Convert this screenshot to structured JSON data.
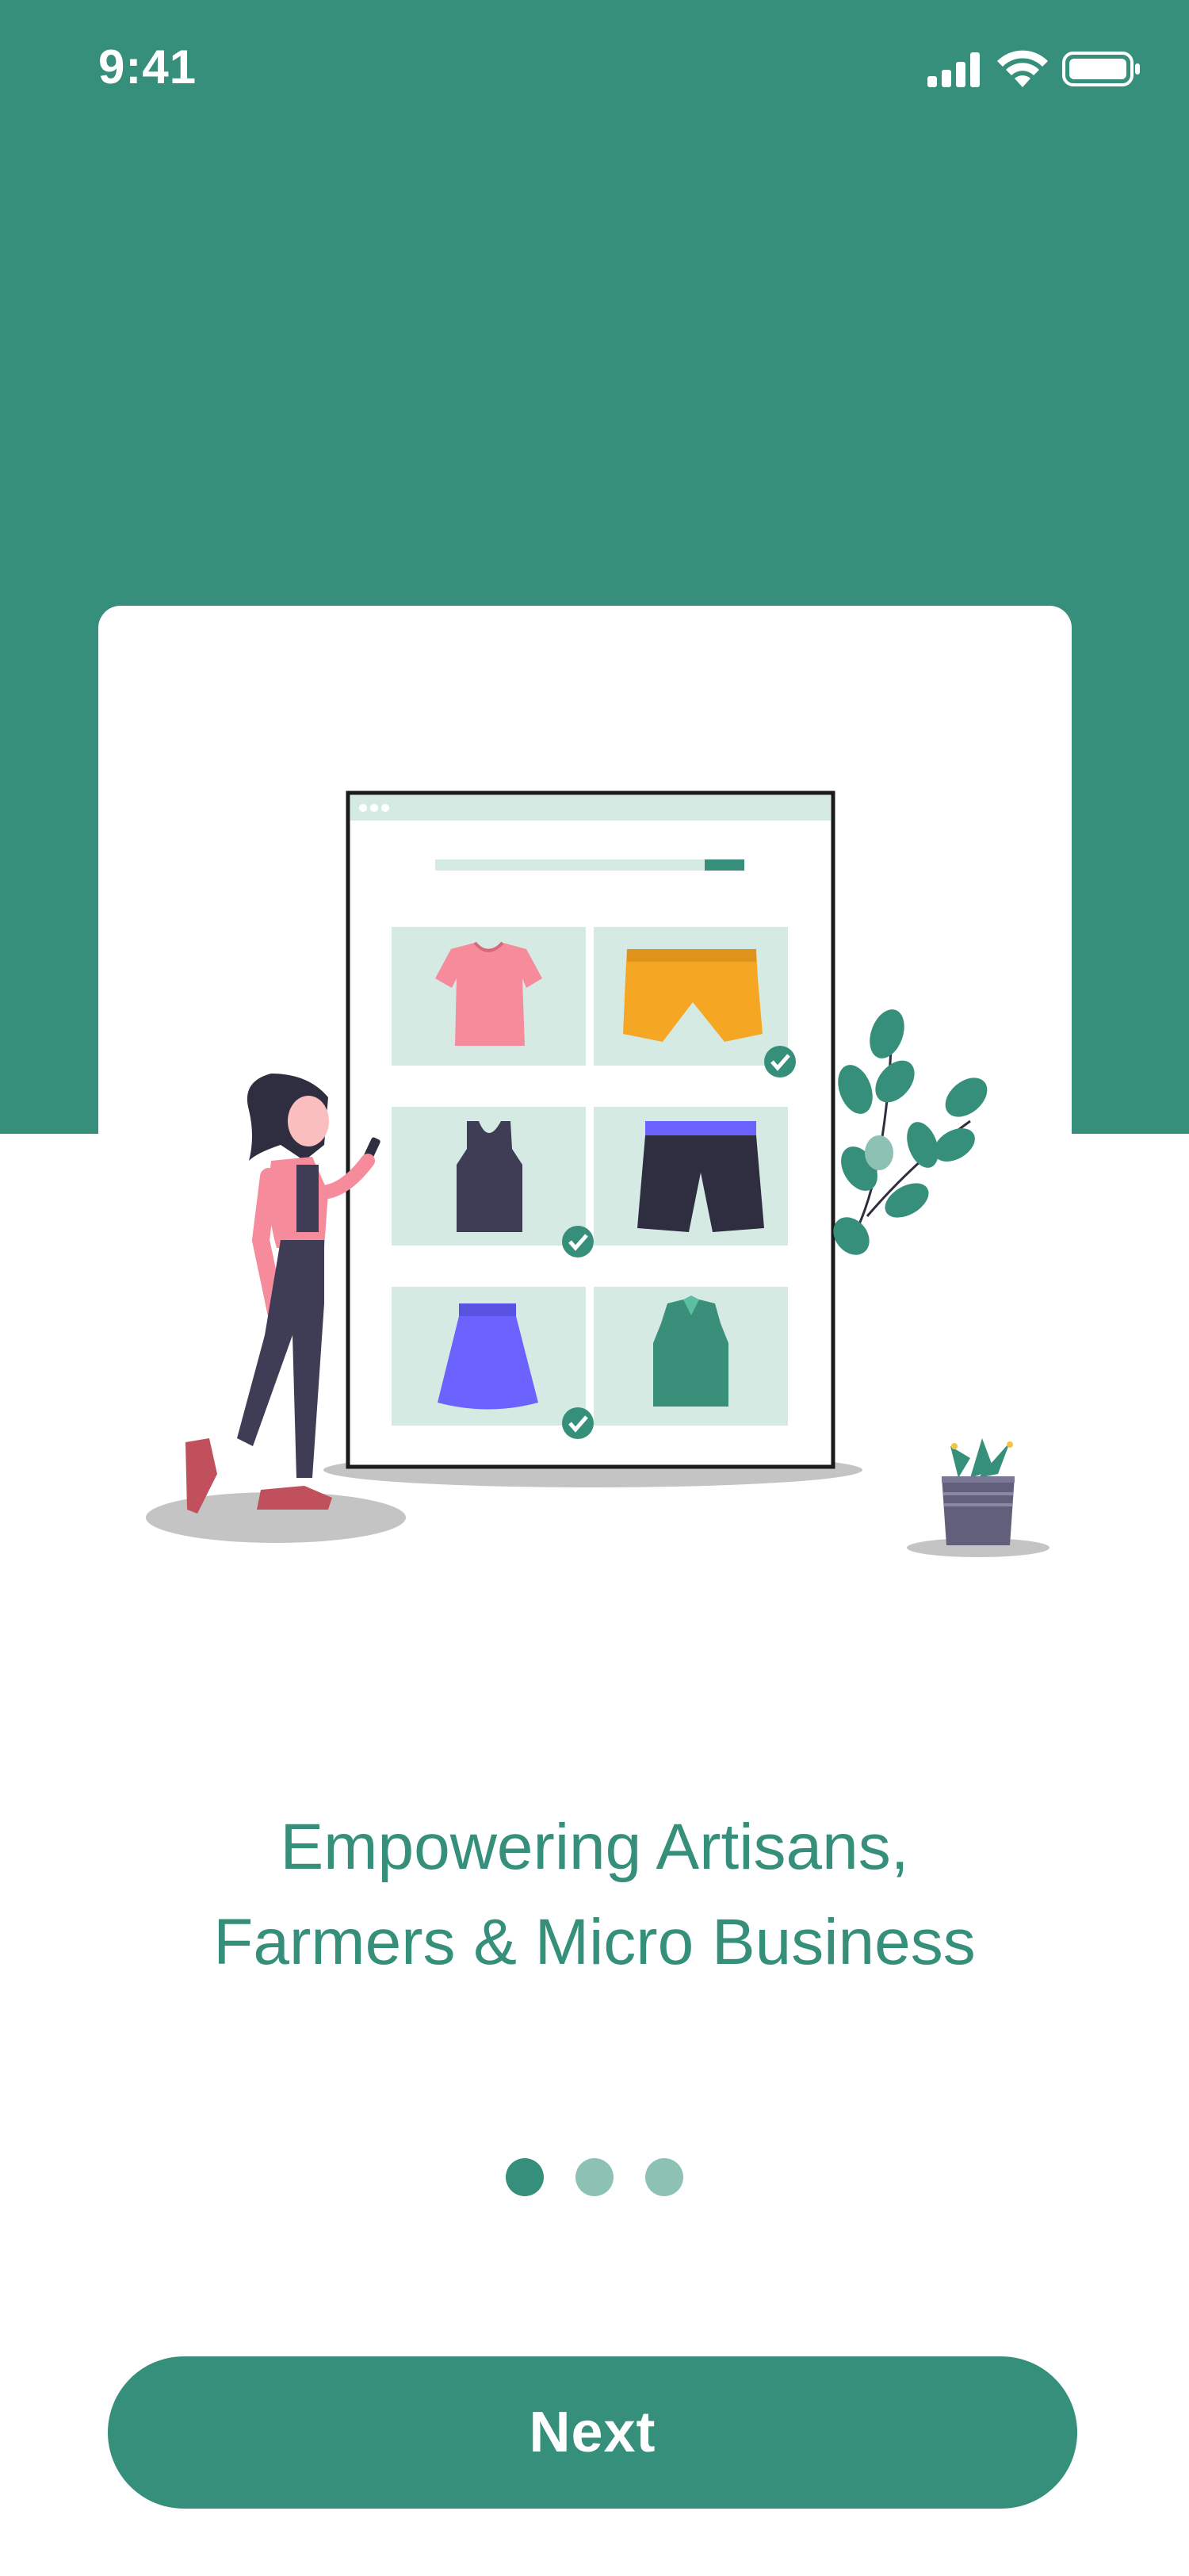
{
  "status_bar": {
    "time": "9:41",
    "icons": [
      "cellular-signal-icon",
      "wifi-icon",
      "battery-icon"
    ]
  },
  "illustration": {
    "description_icons": [
      "woman-with-phone",
      "tablet-shop",
      "t-shirt",
      "shorts",
      "tank-top",
      "black-shorts",
      "skirt",
      "vest",
      "plant",
      "potted-plant"
    ],
    "checked_items": [
      "shorts",
      "tank-top",
      "skirt"
    ]
  },
  "onboarding": {
    "headline_line1": "Empowering Artisans,",
    "headline_line2": "Farmers & Micro Business",
    "pages_total": 3,
    "current_page": 1
  },
  "actions": {
    "next_label": "Next"
  },
  "colors": {
    "brand": "#358f7a",
    "dot_inactive": "#8cc1b3",
    "background": "#ffffff"
  }
}
